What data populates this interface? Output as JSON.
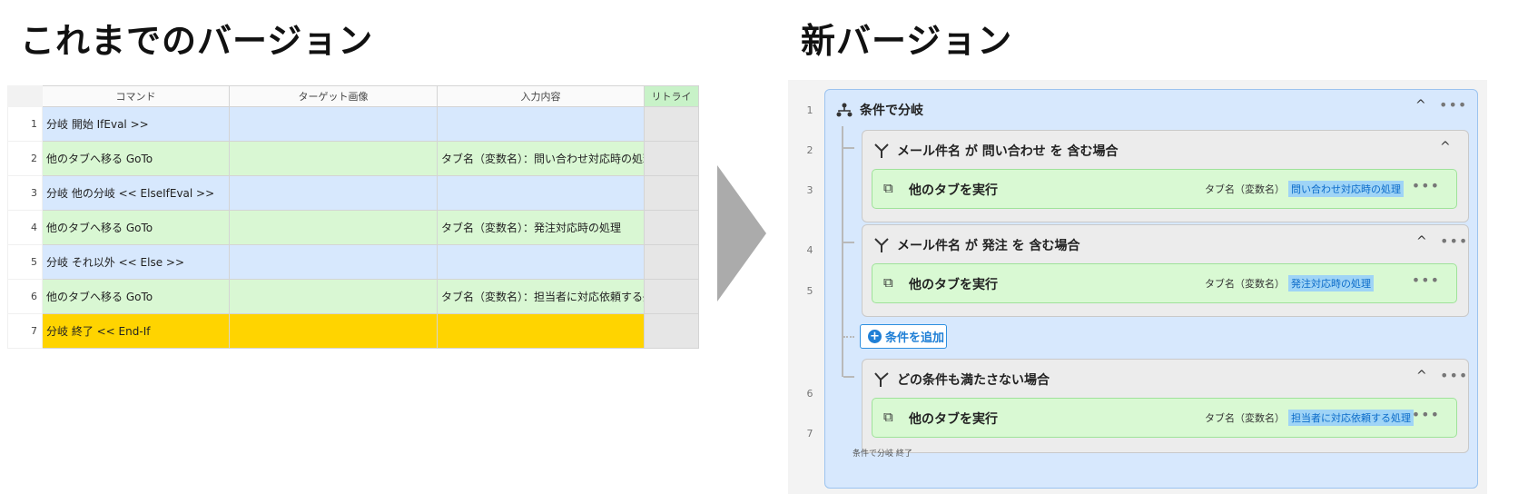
{
  "headings": {
    "old": "これまでのバージョン",
    "new": "新バージョン"
  },
  "old_table": {
    "columns": [
      "コマンド",
      "ターゲット画像",
      "入力内容",
      "リトライ"
    ],
    "rows": [
      {
        "num": "1",
        "command": "分岐 開始 IfEval >>",
        "input": "",
        "color": "blue"
      },
      {
        "num": "2",
        "command": "他のタブへ移る GoTo",
        "input": "タブ名（変数名）：問い合わせ対応時の処理",
        "color": "green"
      },
      {
        "num": "3",
        "command": "分岐 他の分岐 << ElseIfEval >>",
        "input": "",
        "color": "blue"
      },
      {
        "num": "4",
        "command": "他のタブへ移る GoTo",
        "input": "タブ名（変数名）：発注対応時の処理",
        "color": "green"
      },
      {
        "num": "5",
        "command": "分岐 それ以外 << Else >>",
        "input": "",
        "color": "blue"
      },
      {
        "num": "6",
        "command": "他のタブへ移る GoTo",
        "input": "タブ名（変数名）：担当者に対応依頼する処理",
        "color": "green"
      },
      {
        "num": "7",
        "command": "分岐 終了 << End-If",
        "input": "",
        "color": "yellow"
      }
    ]
  },
  "new_panel": {
    "line_numbers": [
      "1",
      "2",
      "3",
      "4",
      "5",
      "6",
      "7"
    ],
    "branch_title": "条件で分岐",
    "conditions": [
      {
        "label": "メール件名 が 問い合わせ を 含む場合",
        "action": "他のタブを実行",
        "param": "タブ名（変数名）",
        "value": "問い合わせ対応時の処理"
      },
      {
        "label": "メール件名 が 発注 を 含む場合",
        "action": "他のタブを実行",
        "param": "タブ名（変数名）",
        "value": "発注対応時の処理"
      },
      {
        "label": "どの条件も満たさない場合",
        "action": "他のタブを実行",
        "param": "タブ名（変数名）",
        "value": "担当者に対応依頼する処理"
      }
    ],
    "add_condition_label": "条件を追加",
    "footer": "条件で分岐 終了",
    "icons": {
      "branch": "branch-icon",
      "condition": "fork-icon",
      "action": "tab-run-icon",
      "more": "more-dots-icon",
      "collapse": "chevron-up-icon",
      "add": "plus-circle-icon"
    }
  }
}
